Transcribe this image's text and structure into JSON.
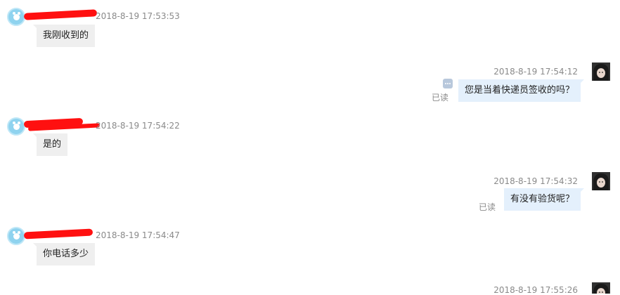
{
  "colors": {
    "left_bubble": "#efefef",
    "right_bubble": "#e4f0fc",
    "timestamp": "#8a8a8a",
    "redaction": "#ff1010",
    "left_avatar": "#8fd3ef",
    "more_icon": "#b8c8dc"
  },
  "icons": {
    "left_avatar": "default-user-avatar-icon",
    "right_avatar": "user-photo-avatar",
    "more": "more-dots-icon"
  },
  "messages": [
    {
      "side": "left",
      "time": "2018-8-19 17:53:53",
      "text": "我刚收到的"
    },
    {
      "side": "right",
      "time": "2018-8-19 17:54:12",
      "text": "您是当着快递员签收的吗？",
      "status": "已读"
    },
    {
      "side": "left",
      "time": "2018-8-19 17:54:22",
      "text": "是的"
    },
    {
      "side": "right",
      "time": "2018-8-19 17:54:32",
      "text": "有没有验货呢？",
      "status": "已读"
    },
    {
      "side": "left",
      "time": "2018-8-19 17:54:47",
      "text": "你电话多少"
    },
    {
      "side": "right",
      "time": "2018-8-19 17:55:26",
      "text": ""
    }
  ]
}
